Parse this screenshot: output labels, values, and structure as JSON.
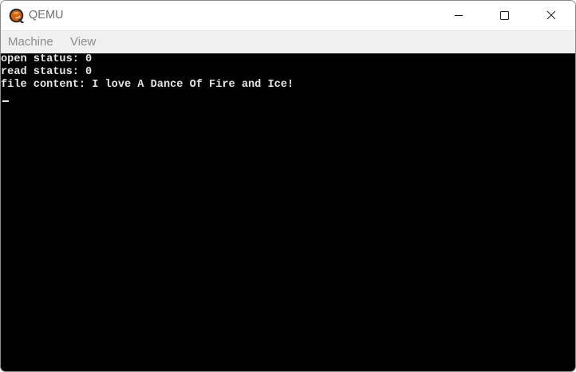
{
  "window": {
    "title": "QEMU",
    "icon": "qemu-logo-icon",
    "controls": [
      "minimize-icon",
      "maximize-icon",
      "close-icon"
    ]
  },
  "menu": {
    "machine": "Machine",
    "view": "View"
  },
  "console": {
    "lines": [
      "open status: 0",
      "read status: 0",
      "file content: I love A Dance Of Fire and Ice!"
    ],
    "cursor": "_"
  },
  "colors": {
    "screen_bg": "#000000",
    "console_text": "#e6e6e6",
    "titlebar_bg": "#ffffff",
    "menubar_bg": "#f0f0f0",
    "menu_text": "#8c8c8c",
    "logo_orange": "#d9620f"
  }
}
